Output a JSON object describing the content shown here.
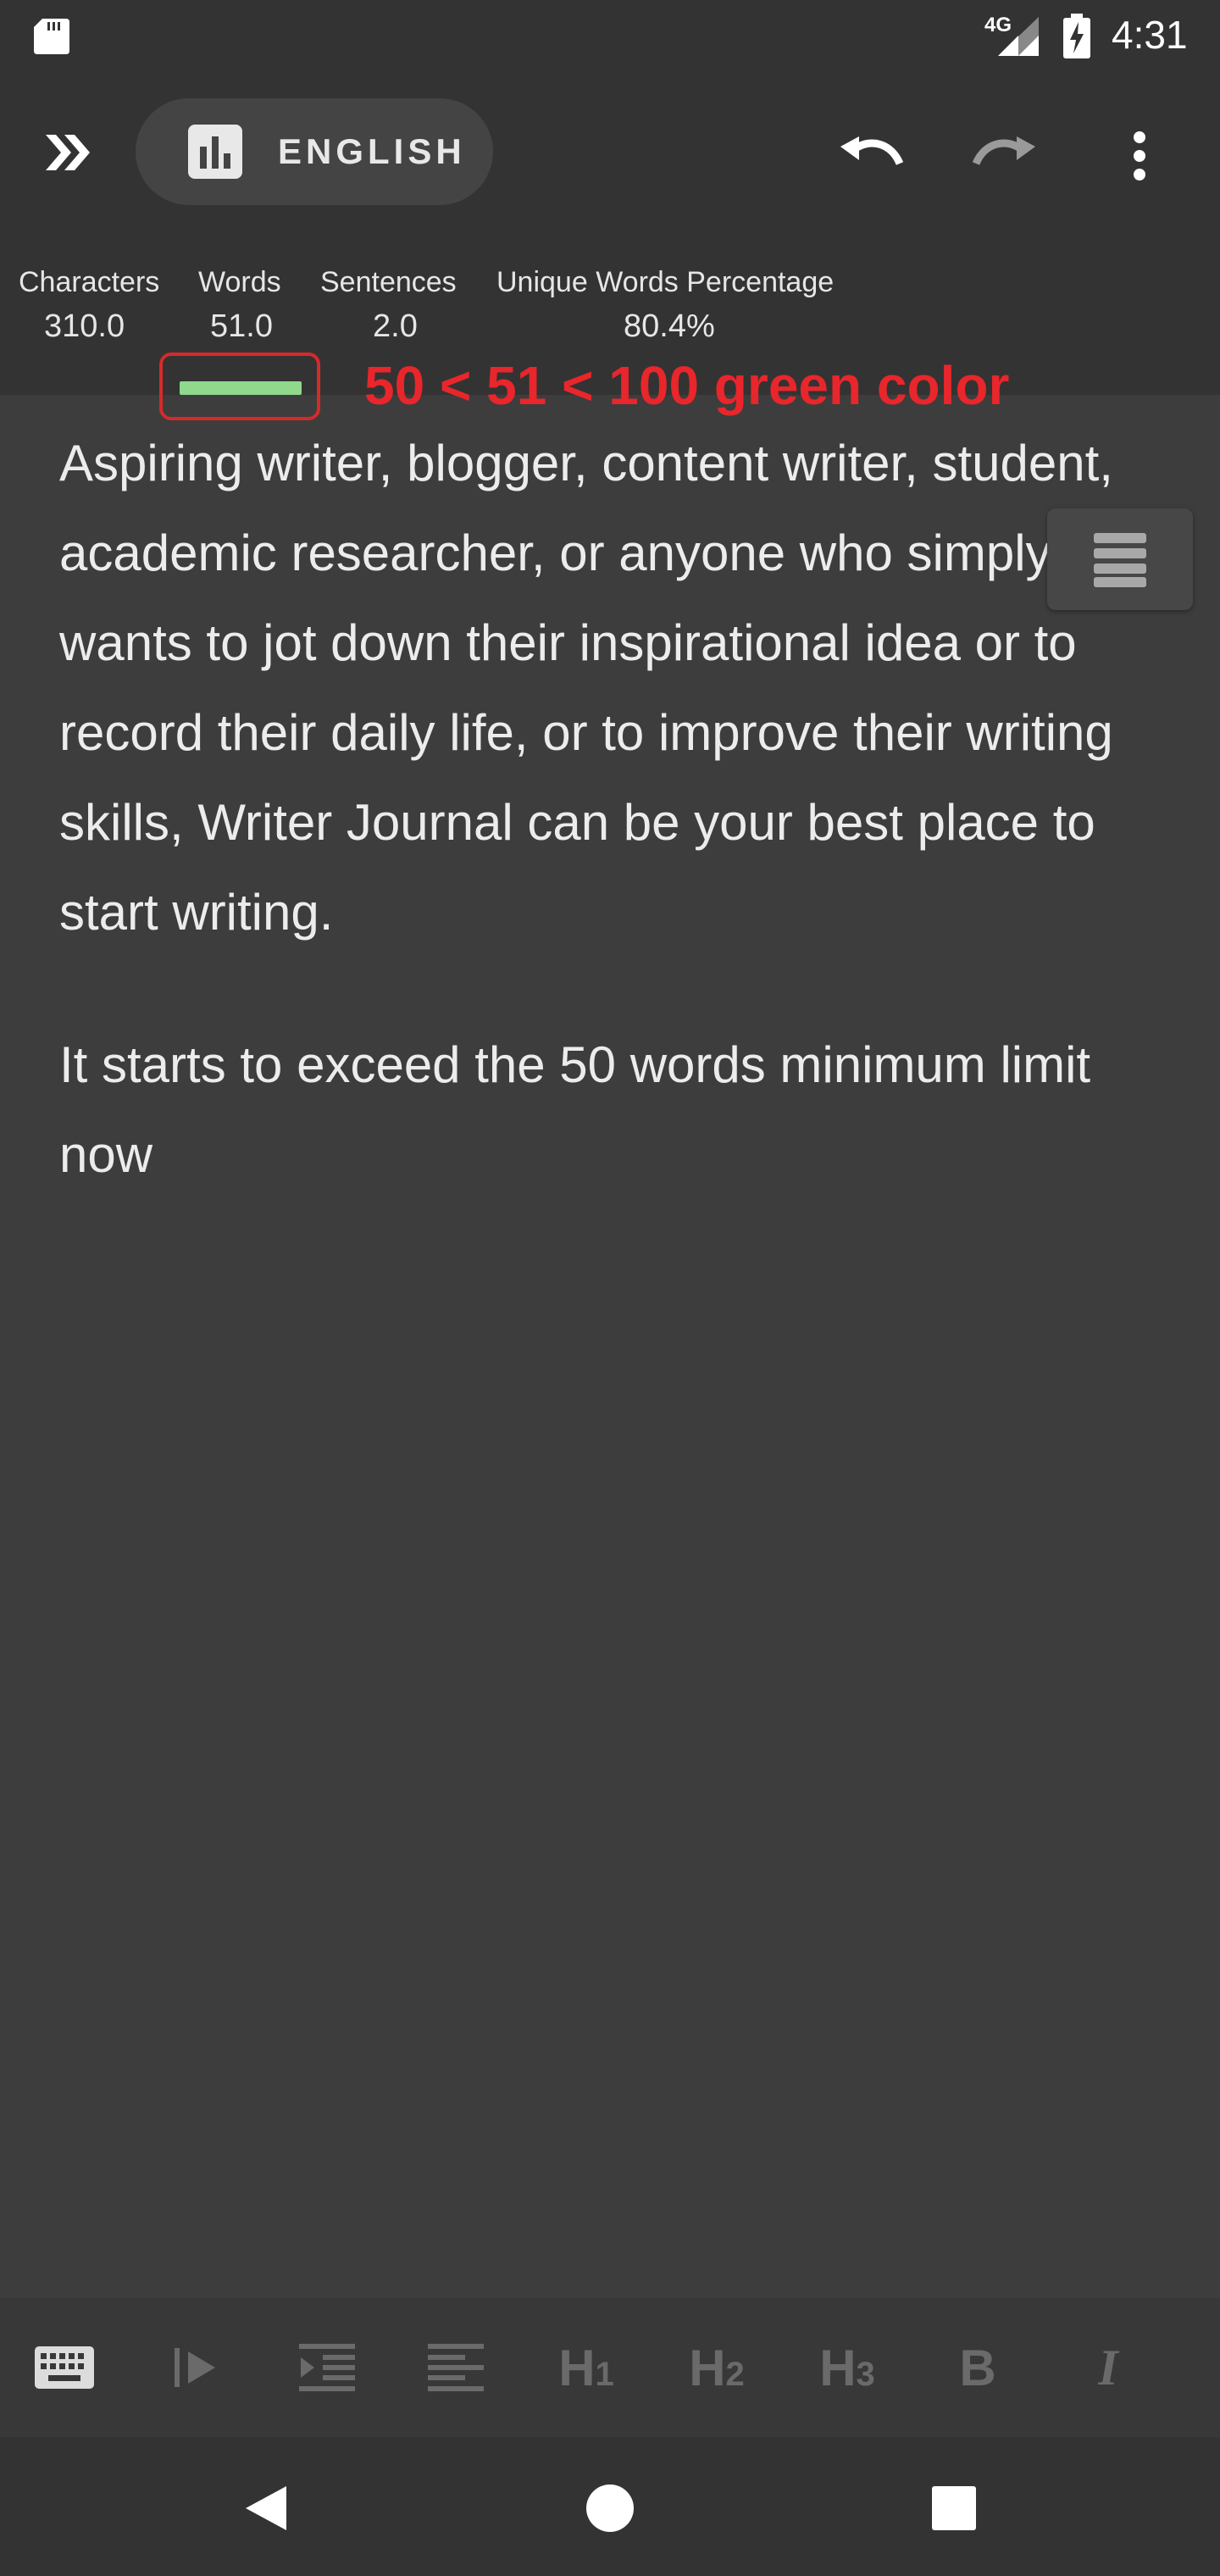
{
  "status_bar": {
    "network": "4G",
    "time": "4:31",
    "icons": [
      "sd-card-icon",
      "signal-icon",
      "battery-charging-icon"
    ]
  },
  "app_bar": {
    "language_label": "ENGLISH",
    "icons": [
      "double-chevron-right-icon",
      "bar-chart-icon",
      "undo-icon",
      "redo-icon",
      "more-vert-icon"
    ]
  },
  "stats": {
    "characters": {
      "label": "Characters",
      "value": "310.0"
    },
    "words": {
      "label": "Words",
      "value": "51.0"
    },
    "sentences": {
      "label": "Sentences",
      "value": "2.0"
    },
    "unique": {
      "label": "Unique Words Percentage",
      "value": "80.4%"
    }
  },
  "annotation": {
    "text": "50 < 51 < 100 green color",
    "indicator_color": "#8fd88c",
    "outline_color": "#d62a2a"
  },
  "editor": {
    "paragraph1": "Aspiring writer, blogger, content writer, student, academic researcher, or anyone who simply wants to jot down their inspirational idea or to record their daily life, or to improve their writing skills, Writer Journal can be your best place to start writing.",
    "paragraph2": "It starts to exceed the 50 words minimum limit now"
  },
  "toolbar": {
    "h1_letter": "H",
    "h1_num": "1",
    "h2_letter": "H",
    "h2_num": "2",
    "h3_letter": "H",
    "h3_num": "3",
    "bold": "B",
    "italic": "I",
    "icons": [
      "keyboard-icon",
      "play-indent-icon",
      "indent-icon",
      "align-left-icon"
    ]
  },
  "nav": {
    "icons": [
      "back-icon",
      "home-icon",
      "recents-icon"
    ]
  }
}
